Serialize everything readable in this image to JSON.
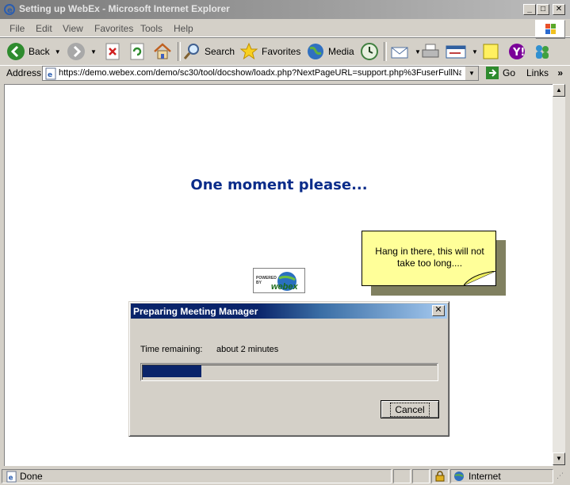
{
  "window": {
    "title": "Setting up WebEx - Microsoft Internet Explorer",
    "minimize_glyph": "_",
    "maximize_glyph": "□",
    "close_glyph": "✕"
  },
  "menubar": {
    "items": [
      "File",
      "Edit",
      "View",
      "Favorites",
      "Tools",
      "Help"
    ]
  },
  "toolbar": {
    "back_label": "Back",
    "search_label": "Search",
    "favorites_label": "Favorites",
    "media_label": "Media"
  },
  "addressbar": {
    "label": "Address",
    "url": "https://demo.webex.com/demo/sc30/tool/docshow/loadx.php?NextPageURL=support.php%3FuserFullNam",
    "go_label": "Go",
    "links_label": "Links"
  },
  "page": {
    "heading": "One moment please...",
    "note_text": "Hang in there, this will not take too long....",
    "powered_by": "POWERED BY",
    "webex_logo": "webex"
  },
  "dialog": {
    "title": "Preparing Meeting Manager",
    "time_label": "Time remaining:",
    "time_value": "about 2 minutes",
    "progress_fraction": 0.2,
    "cancel_label": "Cancel",
    "close_glyph": "✕"
  },
  "statusbar": {
    "status": "Done",
    "zone": "Internet"
  },
  "colors": {
    "heading": "#0a2c8a",
    "note_bg": "#ffff99",
    "dialog_title_start": "#0a246a",
    "progress_fill": "#0a246a"
  }
}
